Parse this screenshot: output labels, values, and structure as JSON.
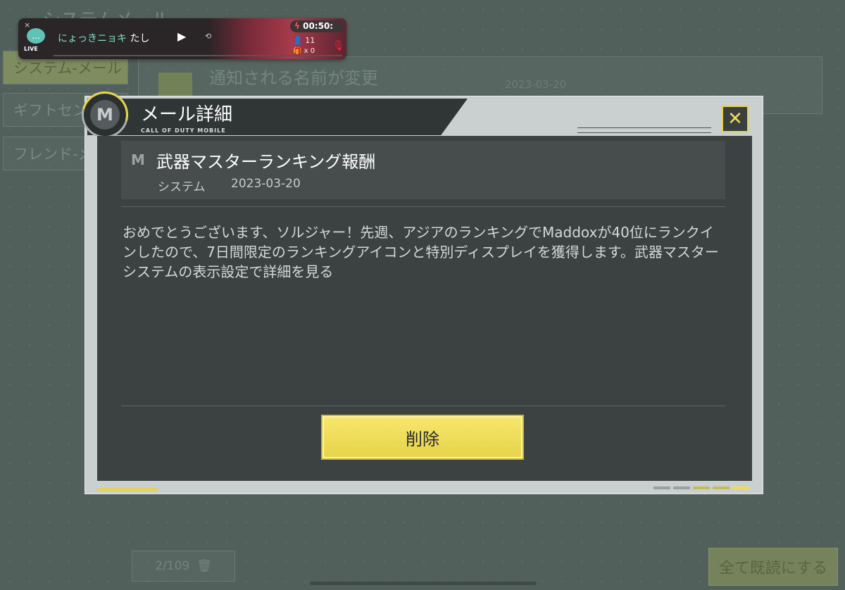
{
  "background": {
    "title": "システムメール",
    "side_tabs": [
      "システム-メール",
      "ギフトセンター",
      "フレンド-メール"
    ],
    "mail_item": {
      "title": "通知される名前が変更",
      "date": "2023-03-20"
    },
    "pagination": "2/109",
    "read_all_button": "全て既読にする"
  },
  "live_overlay": {
    "close": "×",
    "label": "LIVE",
    "streamer_name": "にょっきニョキ",
    "streamer_suffix": "たし",
    "play_icon": "▶",
    "timer": "00:50:",
    "viewers": "11",
    "gifts": "x 0"
  },
  "modal": {
    "title": "メール詳細",
    "subtitle": "CALL OF DUTY MOBILE",
    "close_icon": "x-icon",
    "mail": {
      "subject": "武器マスターランキング報酬",
      "sender": "システム",
      "date": "2023-03-20",
      "body": "おめでとうございます、ソルジャー！先週、アジアのランキングでMaddoxが40位にランクインしたので、7日間限定のランキングアイコンと特別ディスプレイを獲得します。武器マスターシステムの表示設定で詳細を見る"
    },
    "delete_button": "削除"
  },
  "colors": {
    "accent": "#e6d34d",
    "modal_body": "#3c4142",
    "modal_header": "#303536"
  }
}
